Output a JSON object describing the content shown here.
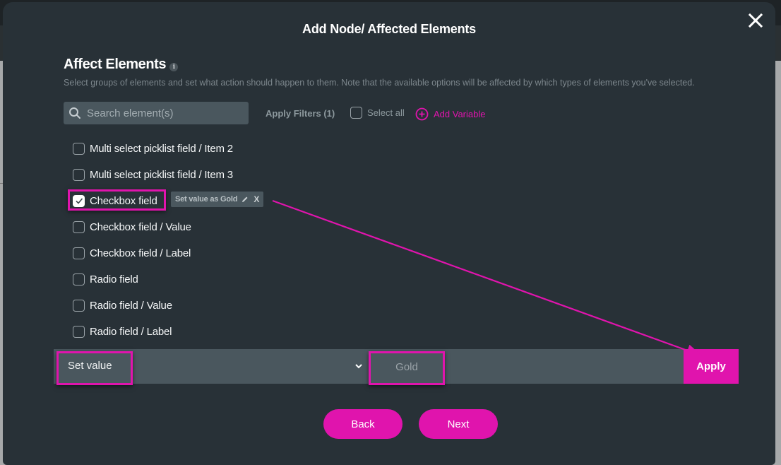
{
  "modal": {
    "title": "Add Node/ Affected Elements"
  },
  "section": {
    "title": "Affect Elements",
    "info_icon": "i",
    "description": "Select groups of elements and set what action should happen to them. Note that the available options will be affected by which types of elements you've selected."
  },
  "toolbar": {
    "search_placeholder": "Search element(s)",
    "search_value": "",
    "apply_filters_label": "Apply Filters (1)",
    "select_all_label": "Select all",
    "select_all_checked": false,
    "add_variable_label": "Add Variable"
  },
  "elements": [
    {
      "label": "Multi select picklist field / Item 2",
      "checked": false
    },
    {
      "label": "Multi select picklist field / Item 3",
      "checked": false
    },
    {
      "label": "Checkbox field",
      "checked": true,
      "tag": "Set value as Gold"
    },
    {
      "label": "Checkbox field / Value",
      "checked": false
    },
    {
      "label": "Checkbox field / Label",
      "checked": false
    },
    {
      "label": "Radio field",
      "checked": false
    },
    {
      "label": "Radio field / Value",
      "checked": false
    },
    {
      "label": "Radio field / Label",
      "checked": false
    }
  ],
  "action_bar": {
    "action_selected": "Set value",
    "value": "Gold",
    "apply_label": "Apply"
  },
  "footer": {
    "back_label": "Back",
    "next_label": "Next"
  },
  "colors": {
    "accent": "#e014ad",
    "modal_bg": "#283137",
    "field_bg": "#4a575e"
  },
  "icons": {
    "close": "close-icon",
    "search": "search-icon",
    "add": "plus-circle-icon",
    "edit": "pencil-icon",
    "remove": "x-icon",
    "dropdown": "chevron-down-icon",
    "check": "check-icon"
  }
}
